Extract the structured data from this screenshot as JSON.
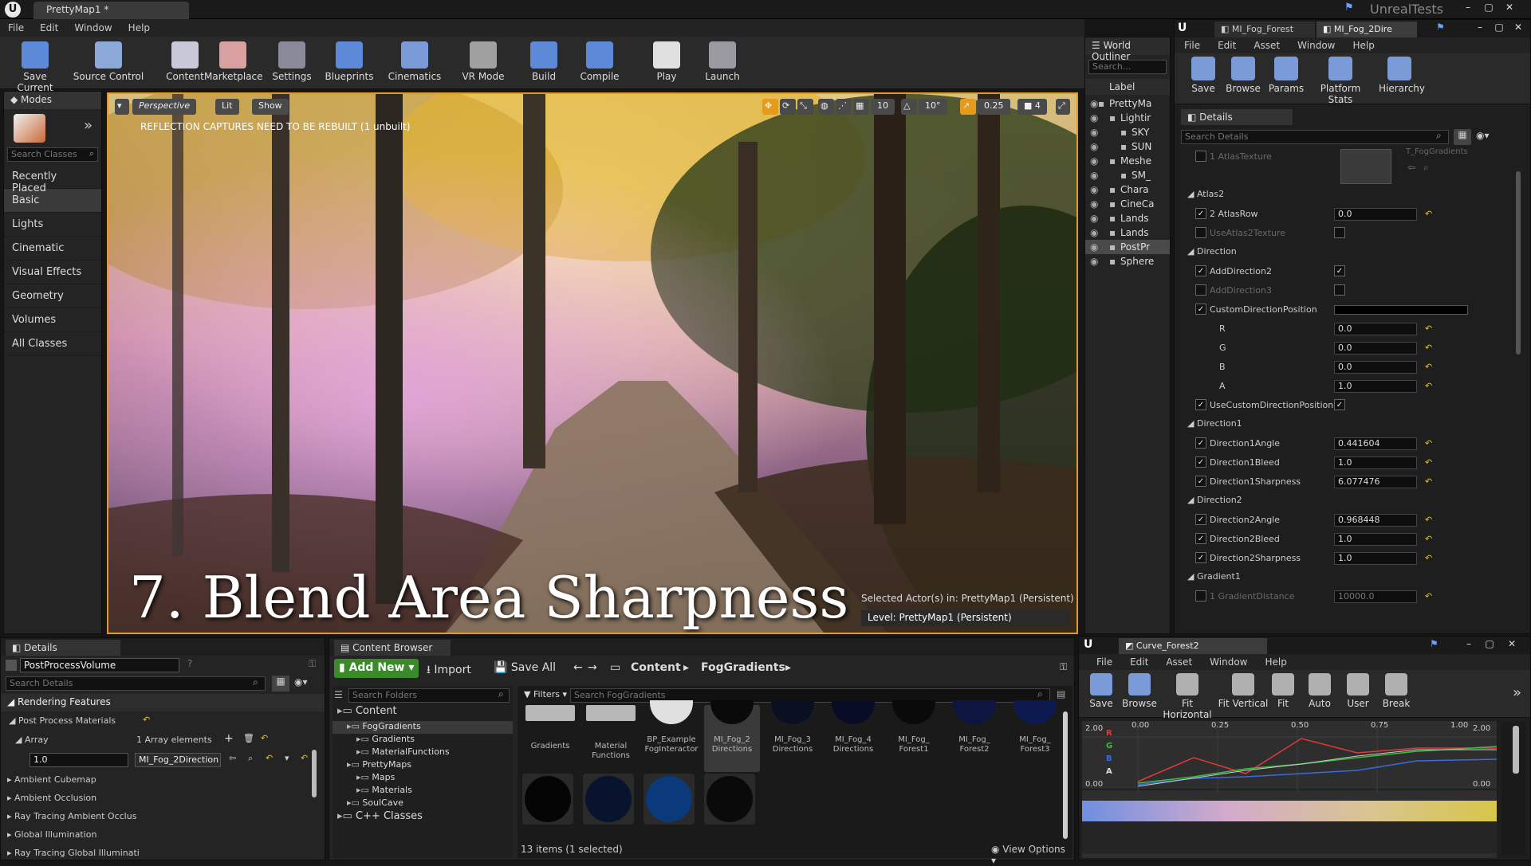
{
  "app": {
    "title_tab": "PrettyMap1 *",
    "brand": "UnrealTests",
    "menu": [
      "File",
      "Edit",
      "Window",
      "Help"
    ]
  },
  "toolbar": [
    {
      "label": "Save Current",
      "icon": "save-icon"
    },
    {
      "label": "Source Control",
      "icon": "source-control-icon"
    },
    {
      "label": "Content",
      "icon": "content-icon"
    },
    {
      "label": "Marketplace",
      "icon": "marketplace-icon"
    },
    {
      "label": "Settings",
      "icon": "settings-icon"
    },
    {
      "label": "Blueprints",
      "icon": "blueprints-icon"
    },
    {
      "label": "Cinematics",
      "icon": "cinematics-icon"
    },
    {
      "label": "VR Mode",
      "icon": "vr-mode-icon"
    },
    {
      "label": "Build",
      "icon": "build-icon"
    },
    {
      "label": "Compile",
      "icon": "compile-icon"
    },
    {
      "label": "Play",
      "icon": "play-icon"
    },
    {
      "label": "Launch",
      "icon": "launch-icon"
    }
  ],
  "modes": {
    "title": "Modes",
    "search_placeholder": "Search Classes",
    "items": [
      "Recently Placed",
      "Basic",
      "Lights",
      "Cinematic",
      "Visual Effects",
      "Geometry",
      "Volumes",
      "All Classes"
    ]
  },
  "viewport": {
    "perspective": "Perspective",
    "lit": "Lit",
    "show": "Show",
    "warning": "REFLECTION CAPTURES NEED TO BE REBUILT (1 unbuilt)",
    "grid": "10",
    "angle": "10°",
    "scale": "0.25",
    "cam": "4",
    "overlay_title": "7. Blend Area Sharpness",
    "selected": "Selected Actor(s) in:  PrettyMap1 (Persistent)",
    "level": "Level:  PrettyMap1 (Persistent)"
  },
  "outliner": {
    "title": "World Outliner",
    "search_placeholder": "Search...",
    "label_header": "Label",
    "rows": [
      "PrettyMa",
      "Lightir",
      "SKY",
      "SUN",
      "Meshe",
      "SM_",
      "Chara",
      "CineCa",
      "Lands",
      "Lands",
      "PostPr",
      "Sphere"
    ]
  },
  "mi_editor": {
    "tabs": [
      "MI_Fog_Forest",
      "MI_Fog_2Dire"
    ],
    "menu": [
      "File",
      "Edit",
      "Asset",
      "Window",
      "Help"
    ],
    "tools": [
      {
        "label": "Save",
        "icon": "save-icon"
      },
      {
        "label": "Browse",
        "icon": "browse-icon"
      },
      {
        "label": "Params",
        "icon": "params-icon"
      },
      {
        "label": "Platform Stats",
        "icon": "platform-stats-icon"
      },
      {
        "label": "Hierarchy",
        "icon": "hierarchy-icon"
      }
    ],
    "details_title": "Details",
    "search_placeholder": "Search Details",
    "fog_hint": "T_FogGradients",
    "rows": [
      {
        "kind": "param",
        "label": "1 AtlasTexture",
        "checked": false,
        "dim": true
      },
      {
        "kind": "cat",
        "label": "Atlas2"
      },
      {
        "kind": "param",
        "label": "2 AtlasRow",
        "checked": true,
        "value": "0.0"
      },
      {
        "kind": "param",
        "label": "UseAtlas2Texture",
        "checked": false,
        "dim": true,
        "bool": false
      },
      {
        "kind": "cat",
        "label": "Direction"
      },
      {
        "kind": "param",
        "label": "AddDirection2",
        "checked": true,
        "bool": true
      },
      {
        "kind": "param",
        "label": "AddDirection3",
        "checked": false,
        "dim": true,
        "bool": false
      },
      {
        "kind": "param",
        "label": "CustomDirectionPosition",
        "checked": true,
        "color": "#000000"
      },
      {
        "kind": "sub",
        "label": "R",
        "value": "0.0"
      },
      {
        "kind": "sub",
        "label": "G",
        "value": "0.0"
      },
      {
        "kind": "sub",
        "label": "B",
        "value": "0.0"
      },
      {
        "kind": "sub",
        "label": "A",
        "value": "1.0"
      },
      {
        "kind": "param",
        "label": "UseCustomDirectionPosition",
        "checked": true,
        "bool": true
      },
      {
        "kind": "cat",
        "label": "Direction1"
      },
      {
        "kind": "param",
        "label": "Direction1Angle",
        "checked": true,
        "value": "0.441604"
      },
      {
        "kind": "param",
        "label": "Direction1Bleed",
        "checked": true,
        "value": "1.0"
      },
      {
        "kind": "param",
        "label": "Direction1Sharpness",
        "checked": true,
        "value": "6.077476"
      },
      {
        "kind": "cat",
        "label": "Direction2"
      },
      {
        "kind": "param",
        "label": "Direction2Angle",
        "checked": true,
        "value": "0.968448"
      },
      {
        "kind": "param",
        "label": "Direction2Bleed",
        "checked": true,
        "value": "1.0"
      },
      {
        "kind": "param",
        "label": "Direction2Sharpness",
        "checked": true,
        "value": "1.0"
      },
      {
        "kind": "cat",
        "label": "Gradient1"
      },
      {
        "kind": "param",
        "label": "1 GradientDistance",
        "checked": false,
        "dim": true,
        "value": "10000.0"
      }
    ]
  },
  "details_bottom": {
    "title": "Details",
    "object_name": "PostProcessVolume",
    "search_placeholder": "Search Details",
    "section": "Rendering Features",
    "ppm": "Post Process Materials",
    "array": "Array",
    "array_count": "1 Array elements",
    "elem_value": "1.0",
    "elem_asset": "MI_Fog_2Direction",
    "others": [
      "Ambient Cubemap",
      "Ambient Occlusion",
      "Ray Tracing Ambient Occlus",
      "Global Illumination",
      "Ray Tracing Global Illuminati"
    ]
  },
  "content_browser": {
    "title": "Content Browser",
    "add_new": "Add New",
    "import": "Import",
    "save_all": "Save All",
    "path": [
      "Content",
      "FogGradients"
    ],
    "folders_placeholder": "Search Folders",
    "filters": "Filters",
    "search_placeholder": "Search FogGradients",
    "tree": [
      {
        "label": "Content",
        "level": 0
      },
      {
        "label": "FogGradients",
        "level": 1
      },
      {
        "label": "Gradients",
        "level": 2
      },
      {
        "label": "MaterialFunctions",
        "level": 2
      },
      {
        "label": "PrettyMaps",
        "level": 1
      },
      {
        "label": "Maps",
        "level": 2
      },
      {
        "label": "Materials",
        "level": 2
      },
      {
        "label": "SoulCave",
        "level": 1
      },
      {
        "label": "C++ Classes",
        "level": 0
      }
    ],
    "assets": [
      {
        "label": "Gradients",
        "color": "#b8b8b8",
        "folder": true
      },
      {
        "label": "Material Functions",
        "color": "#b8b8b8",
        "folder": true
      },
      {
        "label": "BP_Example FogInteractor",
        "color": "#e0e0e0"
      },
      {
        "label": "MI_Fog_2 Directions",
        "color": "#0a0a0a"
      },
      {
        "label": "MI_Fog_3 Directions",
        "color": "#0b0f22"
      },
      {
        "label": "MI_Fog_4 Directions",
        "color": "#080c24"
      },
      {
        "label": "MI_Fog_ Forest1",
        "color": "#0a0a0a"
      },
      {
        "label": "MI_Fog_ Forest2",
        "color": "#0c1640"
      },
      {
        "label": "MI_Fog_ Forest3",
        "color": "#0d1a50"
      }
    ],
    "assets_row2": [
      "#050505",
      "#08132e",
      "#0b3a7a",
      "#0a0a0a"
    ],
    "status": "13 items (1 selected)",
    "view_options": "View Options"
  },
  "curve_editor": {
    "tab": "Curve_Forest2",
    "menu": [
      "File",
      "Edit",
      "Asset",
      "Window",
      "Help"
    ],
    "tools": [
      {
        "label": "Save",
        "icon": "save-icon"
      },
      {
        "label": "Browse",
        "icon": "browse-icon"
      },
      {
        "label": "Fit Horizontal",
        "icon": "fit-horizontal-icon"
      },
      {
        "label": "Fit Vertical",
        "icon": "fit-vertical-icon"
      },
      {
        "label": "Fit",
        "icon": "fit-icon"
      },
      {
        "label": "Auto",
        "icon": "auto-icon"
      },
      {
        "label": "User",
        "icon": "user-icon"
      },
      {
        "label": "Break",
        "icon": "break-icon"
      }
    ],
    "channels": [
      "R",
      "G",
      "B",
      "A"
    ],
    "x_ticks": [
      "0.00",
      "0.25",
      "0.50",
      "0.75",
      "1.00"
    ],
    "y_top": "2.00",
    "y_bottom": "0.00",
    "y_top_right": "2.00",
    "y_bottom_right": "0.00"
  },
  "colors": {
    "accent": "#e69a1c",
    "panel": "#242424",
    "header": "#333333"
  }
}
